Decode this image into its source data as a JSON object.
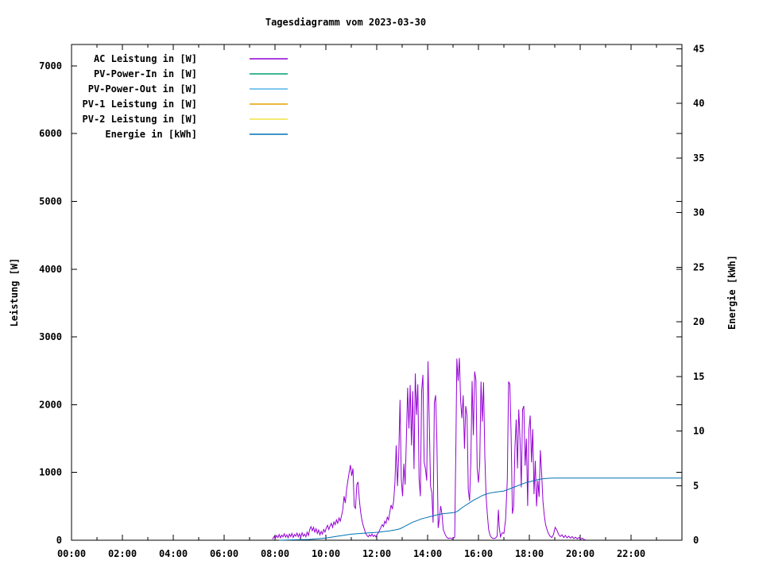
{
  "title": "Tagesdiagramm vom 2023-03-30",
  "chart_data": {
    "type": "line",
    "title": "Tagesdiagramm vom 2023-03-30",
    "background": "#ffffff",
    "text_color": "#000000",
    "grid": false,
    "legend_position": "top-left-inside",
    "x_axis": {
      "kind": "time-of-day",
      "x_unit": "minutes_since_midnight",
      "range_minutes": [
        0,
        1440
      ],
      "major_tick_minutes": 120,
      "minor_tick_minutes": 60,
      "tick_labels": [
        "00:00",
        "02:00",
        "04:00",
        "06:00",
        "08:00",
        "10:00",
        "12:00",
        "14:00",
        "16:00",
        "18:00",
        "20:00",
        "22:00"
      ]
    },
    "y_axis": {
      "label": "Leistung [W]",
      "range": [
        0,
        7316
      ],
      "tick_values": [
        0,
        1000,
        2000,
        3000,
        4000,
        5000,
        6000,
        7000
      ]
    },
    "y2_axis": {
      "label": "Energie [kWh]",
      "range": [
        0,
        45.4
      ],
      "tick_values": [
        0,
        5,
        10,
        15,
        20,
        25,
        30,
        35,
        40,
        45
      ],
      "mirrors_y1_ticks": true
    },
    "series": [
      {
        "name": "AC Leistung in [W]",
        "color": "#9400d3",
        "axis": "y1",
        "points": [
          [
            474,
            15
          ],
          [
            478,
            55
          ],
          [
            481,
            30
          ],
          [
            484,
            70
          ],
          [
            487,
            40
          ],
          [
            490,
            85
          ],
          [
            493,
            35
          ],
          [
            496,
            75
          ],
          [
            499,
            50
          ],
          [
            502,
            95
          ],
          [
            505,
            45
          ],
          [
            508,
            80
          ],
          [
            511,
            35
          ],
          [
            514,
            90
          ],
          [
            517,
            55
          ],
          [
            520,
            100
          ],
          [
            523,
            40
          ],
          [
            526,
            85
          ],
          [
            529,
            60
          ],
          [
            532,
            105
          ],
          [
            535,
            50
          ],
          [
            538,
            95
          ],
          [
            541,
            45
          ],
          [
            544,
            110
          ],
          [
            547,
            60
          ],
          [
            550,
            90
          ],
          [
            553,
            50
          ],
          [
            556,
            120
          ],
          [
            559,
            70
          ],
          [
            562,
            160
          ],
          [
            565,
            200
          ],
          [
            568,
            140
          ],
          [
            571,
            190
          ],
          [
            574,
            120
          ],
          [
            577,
            170
          ],
          [
            580,
            100
          ],
          [
            583,
            150
          ],
          [
            586,
            80
          ],
          [
            589,
            130
          ],
          [
            592,
            90
          ],
          [
            595,
            160
          ],
          [
            598,
            120
          ],
          [
            601,
            180
          ],
          [
            604,
            220
          ],
          [
            607,
            160
          ],
          [
            610,
            210
          ],
          [
            613,
            250
          ],
          [
            616,
            190
          ],
          [
            619,
            270
          ],
          [
            622,
            230
          ],
          [
            625,
            300
          ],
          [
            628,
            250
          ],
          [
            631,
            330
          ],
          [
            634,
            280
          ],
          [
            637,
            360
          ],
          [
            640,
            450
          ],
          [
            643,
            650
          ],
          [
            646,
            550
          ],
          [
            649,
            750
          ],
          [
            652,
            880
          ],
          [
            655,
            1000
          ],
          [
            658,
            1110
          ],
          [
            661,
            950
          ],
          [
            664,
            1060
          ],
          [
            667,
            500
          ],
          [
            670,
            470
          ],
          [
            673,
            820
          ],
          [
            676,
            860
          ],
          [
            679,
            600
          ],
          [
            682,
            420
          ],
          [
            685,
            300
          ],
          [
            688,
            220
          ],
          [
            691,
            160
          ],
          [
            694,
            100
          ],
          [
            697,
            70
          ],
          [
            700,
            50
          ],
          [
            703,
            80
          ],
          [
            706,
            60
          ],
          [
            709,
            90
          ],
          [
            712,
            55
          ],
          [
            715,
            75
          ],
          [
            718,
            50
          ],
          [
            721,
            85
          ],
          [
            724,
            110
          ],
          [
            727,
            150
          ],
          [
            730,
            190
          ],
          [
            733,
            230
          ],
          [
            736,
            200
          ],
          [
            739,
            280
          ],
          [
            742,
            250
          ],
          [
            745,
            340
          ],
          [
            748,
            300
          ],
          [
            751,
            420
          ],
          [
            754,
            520
          ],
          [
            757,
            460
          ],
          [
            760,
            580
          ],
          [
            763,
            850
          ],
          [
            766,
            1400
          ],
          [
            769,
            800
          ],
          [
            772,
            1250
          ],
          [
            775,
            2070
          ],
          [
            778,
            900
          ],
          [
            781,
            650
          ],
          [
            784,
            1130
          ],
          [
            787,
            820
          ],
          [
            790,
            1500
          ],
          [
            793,
            2250
          ],
          [
            796,
            1650
          ],
          [
            799,
            2290
          ],
          [
            802,
            1400
          ],
          [
            805,
            2200
          ],
          [
            808,
            1050
          ],
          [
            811,
            2460
          ],
          [
            814,
            1850
          ],
          [
            817,
            2300
          ],
          [
            820,
            900
          ],
          [
            823,
            650
          ],
          [
            826,
            2200
          ],
          [
            829,
            2440
          ],
          [
            832,
            1150
          ],
          [
            835,
            1050
          ],
          [
            838,
            880
          ],
          [
            841,
            2640
          ],
          [
            844,
            1750
          ],
          [
            847,
            800
          ],
          [
            850,
            700
          ],
          [
            853,
            260
          ],
          [
            856,
            2030
          ],
          [
            859,
            2140
          ],
          [
            862,
            1450
          ],
          [
            865,
            180
          ],
          [
            868,
            320
          ],
          [
            871,
            505
          ],
          [
            874,
            380
          ],
          [
            877,
            160
          ],
          [
            881,
            90
          ],
          [
            885,
            45
          ],
          [
            889,
            25
          ],
          [
            893,
            35
          ],
          [
            897,
            20
          ],
          [
            901,
            30
          ],
          [
            904,
            45
          ],
          [
            907,
            1500
          ],
          [
            909,
            2680
          ],
          [
            912,
            2350
          ],
          [
            915,
            2690
          ],
          [
            918,
            2050
          ],
          [
            921,
            1800
          ],
          [
            924,
            2140
          ],
          [
            927,
            1350
          ],
          [
            930,
            1980
          ],
          [
            933,
            1840
          ],
          [
            936,
            750
          ],
          [
            939,
            580
          ],
          [
            942,
            1150
          ],
          [
            945,
            2350
          ],
          [
            948,
            1550
          ],
          [
            951,
            2490
          ],
          [
            954,
            2370
          ],
          [
            957,
            1050
          ],
          [
            960,
            850
          ],
          [
            963,
            1140
          ],
          [
            966,
            2340
          ],
          [
            969,
            1750
          ],
          [
            972,
            2330
          ],
          [
            975,
            1250
          ],
          [
            978,
            650
          ],
          [
            981,
            380
          ],
          [
            984,
            160
          ],
          [
            987,
            80
          ],
          [
            990,
            45
          ],
          [
            993,
            30
          ],
          [
            996,
            25
          ],
          [
            1000,
            30
          ],
          [
            1004,
            60
          ],
          [
            1007,
            450
          ],
          [
            1009,
            200
          ],
          [
            1012,
            50
          ],
          [
            1016,
            110
          ],
          [
            1020,
            100
          ],
          [
            1024,
            300
          ],
          [
            1028,
            900
          ],
          [
            1031,
            2340
          ],
          [
            1034,
            2300
          ],
          [
            1037,
            1550
          ],
          [
            1040,
            390
          ],
          [
            1043,
            500
          ],
          [
            1046,
            1370
          ],
          [
            1049,
            1780
          ],
          [
            1052,
            1060
          ],
          [
            1055,
            1930
          ],
          [
            1058,
            1480
          ],
          [
            1061,
            780
          ],
          [
            1064,
            1930
          ],
          [
            1067,
            1980
          ],
          [
            1070,
            1100
          ],
          [
            1073,
            1500
          ],
          [
            1076,
            505
          ],
          [
            1079,
            1630
          ],
          [
            1082,
            1840
          ],
          [
            1085,
            1150
          ],
          [
            1088,
            1640
          ],
          [
            1091,
            680
          ],
          [
            1094,
            1170
          ],
          [
            1097,
            500
          ],
          [
            1100,
            880
          ],
          [
            1103,
            640
          ],
          [
            1106,
            1330
          ],
          [
            1109,
            980
          ],
          [
            1112,
            580
          ],
          [
            1115,
            380
          ],
          [
            1118,
            240
          ],
          [
            1121,
            170
          ],
          [
            1125,
            100
          ],
          [
            1129,
            60
          ],
          [
            1133,
            40
          ],
          [
            1137,
            85
          ],
          [
            1141,
            190
          ],
          [
            1145,
            150
          ],
          [
            1149,
            85
          ],
          [
            1153,
            55
          ],
          [
            1157,
            80
          ],
          [
            1161,
            40
          ],
          [
            1165,
            70
          ],
          [
            1169,
            35
          ],
          [
            1173,
            60
          ],
          [
            1177,
            30
          ],
          [
            1181,
            55
          ],
          [
            1185,
            25
          ],
          [
            1189,
            45
          ],
          [
            1193,
            20
          ],
          [
            1197,
            40
          ],
          [
            1201,
            15
          ],
          [
            1205,
            30
          ],
          [
            1209,
            10
          ],
          [
            1213,
            5
          ]
        ]
      },
      {
        "name": "PV-Power-In in [W]",
        "color": "#009e73",
        "axis": "y1",
        "points": []
      },
      {
        "name": "PV-Power-Out in [W]",
        "color": "#56b4e9",
        "axis": "y1",
        "points": []
      },
      {
        "name": "PV-1 Leistung in [W]",
        "color": "#e69f00",
        "axis": "y1",
        "points": []
      },
      {
        "name": "PV-2 Leistung in [W]",
        "color": "#f0e442",
        "axis": "y1",
        "points": []
      },
      {
        "name": "Energie in [kWh]",
        "color": "#0072b2",
        "axis": "y2",
        "points": [
          [
            490,
            0
          ],
          [
            560,
            0.07
          ],
          [
            600,
            0.2
          ],
          [
            630,
            0.38
          ],
          [
            660,
            0.55
          ],
          [
            690,
            0.65
          ],
          [
            720,
            0.72
          ],
          [
            750,
            0.85
          ],
          [
            765,
            0.95
          ],
          [
            775,
            1.05
          ],
          [
            785,
            1.25
          ],
          [
            795,
            1.45
          ],
          [
            805,
            1.65
          ],
          [
            815,
            1.8
          ],
          [
            825,
            1.95
          ],
          [
            835,
            2.05
          ],
          [
            845,
            2.15
          ],
          [
            855,
            2.25
          ],
          [
            865,
            2.35
          ],
          [
            875,
            2.42
          ],
          [
            890,
            2.48
          ],
          [
            905,
            2.55
          ],
          [
            912,
            2.7
          ],
          [
            920,
            2.95
          ],
          [
            930,
            3.2
          ],
          [
            940,
            3.45
          ],
          [
            950,
            3.7
          ],
          [
            960,
            3.9
          ],
          [
            970,
            4.1
          ],
          [
            980,
            4.25
          ],
          [
            990,
            4.35
          ],
          [
            1000,
            4.4
          ],
          [
            1010,
            4.45
          ],
          [
            1020,
            4.5
          ],
          [
            1030,
            4.65
          ],
          [
            1040,
            4.8
          ],
          [
            1050,
            4.95
          ],
          [
            1060,
            5.1
          ],
          [
            1070,
            5.25
          ],
          [
            1080,
            5.35
          ],
          [
            1090,
            5.45
          ],
          [
            1100,
            5.55
          ],
          [
            1110,
            5.62
          ],
          [
            1120,
            5.66
          ],
          [
            1130,
            5.68
          ],
          [
            1140,
            5.7
          ],
          [
            1440,
            5.7
          ]
        ]
      }
    ]
  }
}
